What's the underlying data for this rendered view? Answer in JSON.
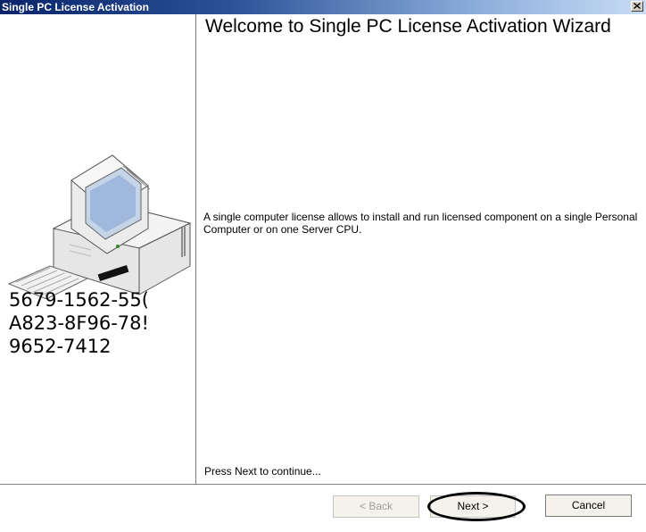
{
  "window": {
    "title": "Single PC License Activation",
    "close_icon": "close-icon"
  },
  "left_panel": {
    "illustration": "computer-icon",
    "code_lines": [
      "5679-1562-55(",
      "A823-8F96-78!",
      "9652-7412"
    ]
  },
  "content": {
    "heading": "Welcome to Single PC License Activation Wizard",
    "description": "A single computer license allows to install and run licensed component on a single Personal Computer or on one Server CPU.",
    "hint": "Press Next to continue..."
  },
  "buttons": {
    "back_label": "< Back",
    "next_label": "Next >",
    "cancel_label": "Cancel",
    "back_enabled": false
  },
  "colors": {
    "titlebar_start": "#0a246a",
    "titlebar_end": "#c8dcf5",
    "highlight_oval": "#000000"
  }
}
